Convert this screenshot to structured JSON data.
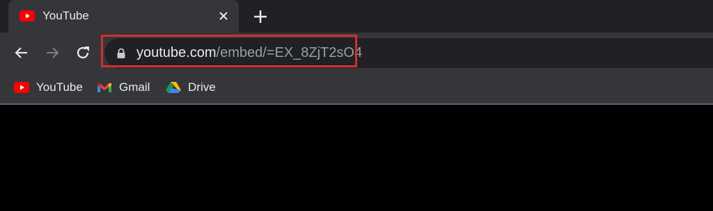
{
  "tab": {
    "title": "YouTube",
    "favicon": "youtube-icon",
    "close_icon": "close-icon"
  },
  "new_tab_icon": "plus-icon",
  "toolbar": {
    "back_icon": "arrow-left-icon",
    "forward_icon": "arrow-right-icon",
    "reload_icon": "reload-icon",
    "lock_icon": "lock-icon"
  },
  "address_bar": {
    "host": "youtube.com",
    "path": "/embed/=EX_8ZjT2sO4",
    "highlight_color": "#d32f2f"
  },
  "bookmarks": [
    {
      "label": "YouTube",
      "icon": "youtube-icon"
    },
    {
      "label": "Gmail",
      "icon": "gmail-icon"
    },
    {
      "label": "Drive",
      "icon": "google-drive-icon"
    }
  ],
  "colors": {
    "tabstrip_bg": "#202124",
    "toolbar_bg": "#35363a",
    "omnibox_bg": "#202124",
    "text": "#e8eaed",
    "muted_text": "#9aa0a6",
    "content_bg": "#000000"
  }
}
